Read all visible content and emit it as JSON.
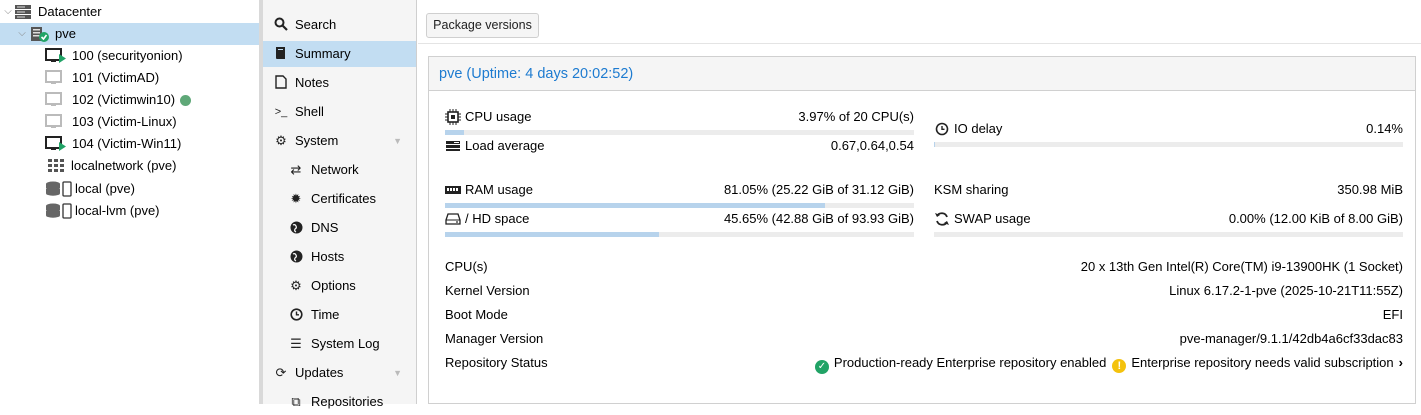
{
  "tree": {
    "datacenter": "Datacenter",
    "node": "pve",
    "items": [
      {
        "label": "100 (securityonion)",
        "icon": "vm-running-icon"
      },
      {
        "label": "101 (VictimAD)",
        "icon": "vm-stopped-icon"
      },
      {
        "label": "102 (Victimwin10)",
        "icon": "vm-stopped-icon"
      },
      {
        "label": "103 (Victim-Linux)",
        "icon": "vm-stopped-icon"
      },
      {
        "label": "104 (Victim-Win11)",
        "icon": "vm-running-icon"
      },
      {
        "label": "localnetwork (pve)",
        "icon": "network-grid-icon"
      },
      {
        "label": "local (pve)",
        "icon": "storage-icon"
      },
      {
        "label": "local-lvm (pve)",
        "icon": "storage-icon"
      }
    ]
  },
  "nav": {
    "items": [
      {
        "label": "Search",
        "icon": "search-icon"
      },
      {
        "label": "Summary",
        "icon": "book-icon"
      },
      {
        "label": "Notes",
        "icon": "notes-icon"
      },
      {
        "label": "Shell",
        "icon": "terminal-icon"
      },
      {
        "label": "System",
        "icon": "gears-icon"
      },
      {
        "label": "Network",
        "icon": "exchange-icon"
      },
      {
        "label": "Certificates",
        "icon": "certificate-icon"
      },
      {
        "label": "DNS",
        "icon": "globe-icon"
      },
      {
        "label": "Hosts",
        "icon": "globe-icon"
      },
      {
        "label": "Options",
        "icon": "gear-icon"
      },
      {
        "label": "Time",
        "icon": "clock-icon"
      },
      {
        "label": "System Log",
        "icon": "list-icon"
      },
      {
        "label": "Updates",
        "icon": "refresh-icon"
      },
      {
        "label": "Repositories",
        "icon": "package-icon"
      }
    ]
  },
  "toolbar": {
    "package_versions": "Package versions"
  },
  "summary": {
    "title": "pve (Uptime: 4 days 20:02:52)",
    "cpu": {
      "label": "CPU usage",
      "value": "3.97% of 20 CPU(s)",
      "pct": 3.97
    },
    "load": {
      "label": "Load average",
      "value": "0.67,0.64,0.54"
    },
    "io": {
      "label": "IO delay",
      "value": "0.14%",
      "pct": 0.14
    },
    "ram": {
      "label": "RAM usage",
      "value": "81.05% (25.22 GiB of 31.12 GiB)",
      "pct": 81.05
    },
    "hd": {
      "label": "/ HD space",
      "value": "45.65% (42.88 GiB of 93.93 GiB)",
      "pct": 45.65
    },
    "ksm": {
      "label": "KSM sharing",
      "value": "350.98 MiB"
    },
    "swap": {
      "label": "SWAP usage",
      "value": "0.00% (12.00 KiB of 8.00 GiB)",
      "pct": 0.0
    },
    "info": [
      {
        "label": "CPU(s)",
        "value": "20 x 13th Gen Intel(R) Core(TM) i9-13900HK (1 Socket)"
      },
      {
        "label": "Kernel Version",
        "value": "Linux 6.17.2-1-pve (2025-10-21T11:55Z)"
      },
      {
        "label": "Boot Mode",
        "value": "EFI"
      },
      {
        "label": "Manager Version",
        "value": "pve-manager/9.1.1/42db4a6cf33dac83"
      }
    ],
    "repo": {
      "label": "Repository Status",
      "ok": "Production-ready Enterprise repository enabled",
      "warn": "Enterprise repository needs valid subscription"
    }
  },
  "colors": {
    "selection": "#c2ddf2",
    "accent": "#1d7bd0",
    "running": "#21a366",
    "warn": "#f4c20d"
  }
}
